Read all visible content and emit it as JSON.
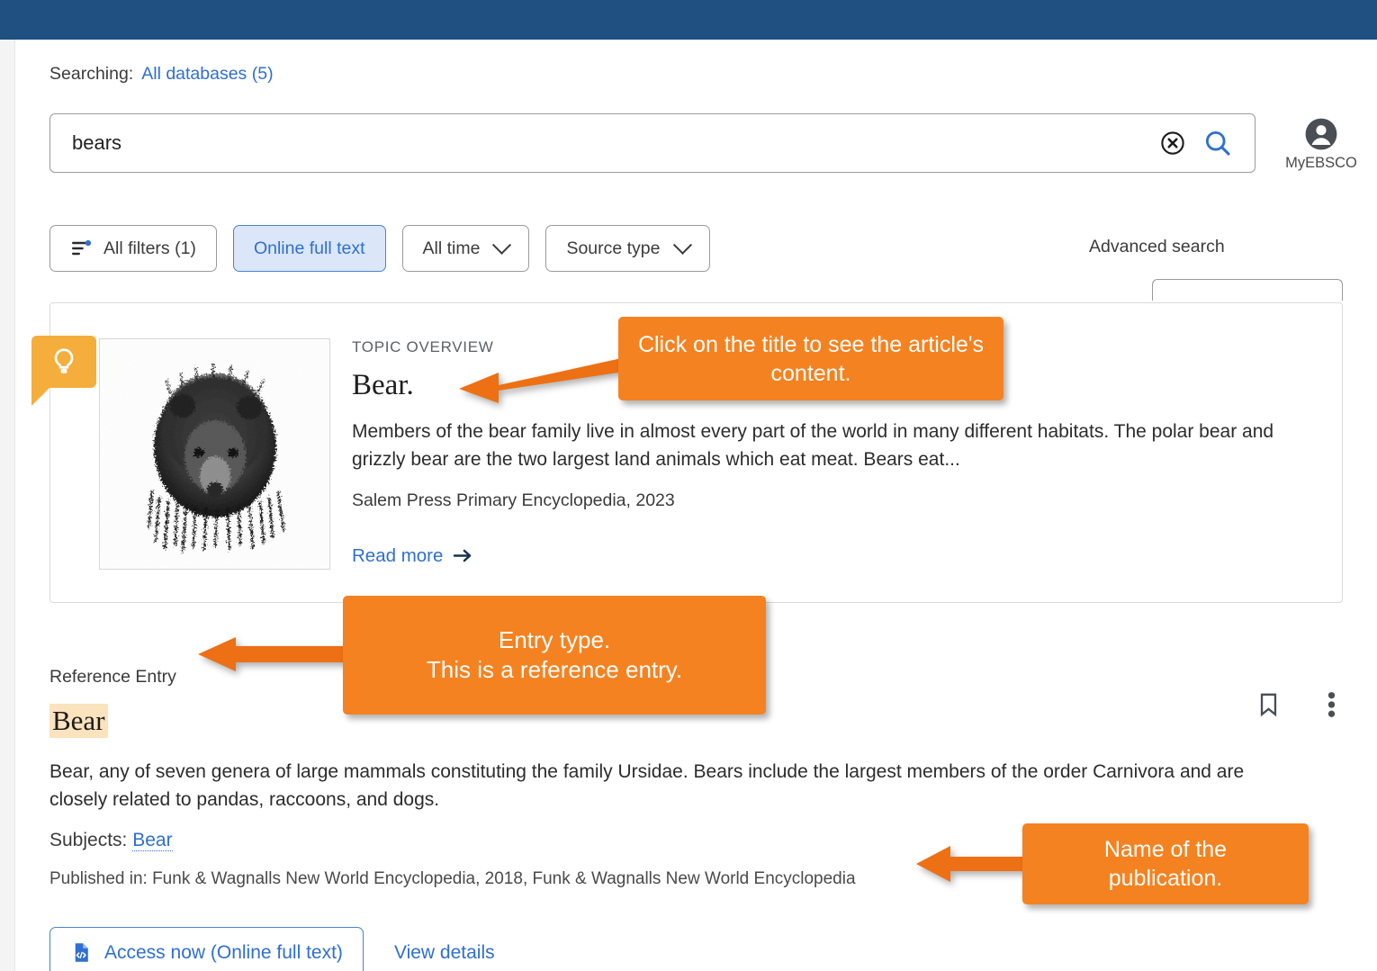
{
  "topbar": {
    "color": "#1f5081"
  },
  "search": {
    "searching_label": "Searching:",
    "database_link": "All databases (5)",
    "query_value": "bears",
    "query_placeholder": "Search",
    "clear_icon": "clear-circle-icon",
    "search_icon": "search-icon"
  },
  "account": {
    "label": "MyEBSCO",
    "icon": "account-avatar-icon"
  },
  "filters": {
    "all_filters": "All filters (1)",
    "online_full_text": "Online full text",
    "all_time": "All time",
    "source_type": "Source type",
    "advanced_search": "Advanced search",
    "filter_icon": "filter-sliders-icon",
    "active_chip_bg": "#dbe7f8",
    "active_chip_border": "#4a82cf"
  },
  "topic_overview": {
    "badge_icon": "lightbulb-icon",
    "badge_color": "#f5ad3c",
    "thumbnail_alt": "bear-engraving-thumbnail",
    "kicker": "TOPIC OVERVIEW",
    "title": "Bear.",
    "description": "Members of the bear family live in almost every part of the world in many different habitats. The polar bear and grizzly bear are the two largest land animals which eat meat. Bears eat...",
    "source": "Salem Press Primary Encyclopedia, 2023",
    "read_more": "Read more",
    "read_more_icon": "arrow-right-icon"
  },
  "result": {
    "entry_type": "Reference Entry",
    "title": "Bear",
    "title_highlight_color": "#fbe3bd",
    "abstract": "Bear, any of seven genera of large mammals constituting the family Ursidae. Bears include the largest members of the order Carnivora and are closely related to pandas, raccoons, and dogs.",
    "subjects_label": "Subjects:",
    "subject_link": "Bear",
    "published_in": "Published in: Funk & Wagnalls New World Encyclopedia, 2018, Funk & Wagnalls New World Encyclopedia",
    "access_button": "Access now (Online full text)",
    "access_icon": "document-code-icon",
    "view_details": "View details",
    "bookmark_icon": "bookmark-icon",
    "more_icon": "more-vertical-icon"
  },
  "annotations": {
    "color": "#f58220",
    "callout_1": "Click on the title to see the article's content.",
    "callout_2": "Entry type.\nThis is a reference entry.",
    "callout_2_line_1": "Entry type.",
    "callout_2_line_2": "This is a reference entry.",
    "callout_3": "Name of the publication.",
    "callout_3_line_1": "Name of the",
    "callout_3_line_2": "publication."
  }
}
